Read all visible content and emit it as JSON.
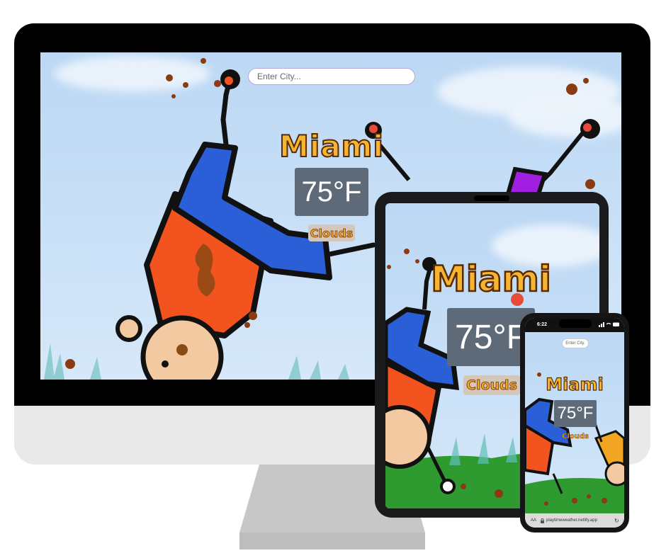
{
  "search": {
    "placeholder": "Enter City..."
  },
  "weather": {
    "city": "Miami",
    "temperature": "75°F",
    "condition": "Clouds"
  },
  "phone": {
    "time": "6:22",
    "search_placeholder": "Enter City.",
    "text_size_label": "AA",
    "url": "playtimeweather.netlify.app",
    "reload_glyph": "↻"
  },
  "icons": [
    "lock-icon",
    "reload-icon",
    "signal-icon",
    "wifi-icon",
    "battery-icon"
  ]
}
